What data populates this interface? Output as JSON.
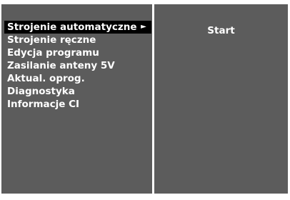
{
  "menu": {
    "items": [
      {
        "label": "Strojenie automatyczne",
        "selected": true,
        "has_submenu": true
      },
      {
        "label": "Strojenie ręczne"
      },
      {
        "label": "Edycja programu"
      },
      {
        "label": "Zasilanie anteny 5V"
      },
      {
        "label": "Aktual. oprog."
      },
      {
        "label": "Diagnostyka"
      },
      {
        "label": "Informacje CI"
      }
    ],
    "submenu_arrow_icon": "►"
  },
  "submenu": {
    "items": [
      {
        "label": "Start"
      }
    ]
  },
  "colors": {
    "panel_background": "#5c5c5c",
    "selected_background": "#000000",
    "text": "#ffffff",
    "page_background": "#ffffff"
  }
}
